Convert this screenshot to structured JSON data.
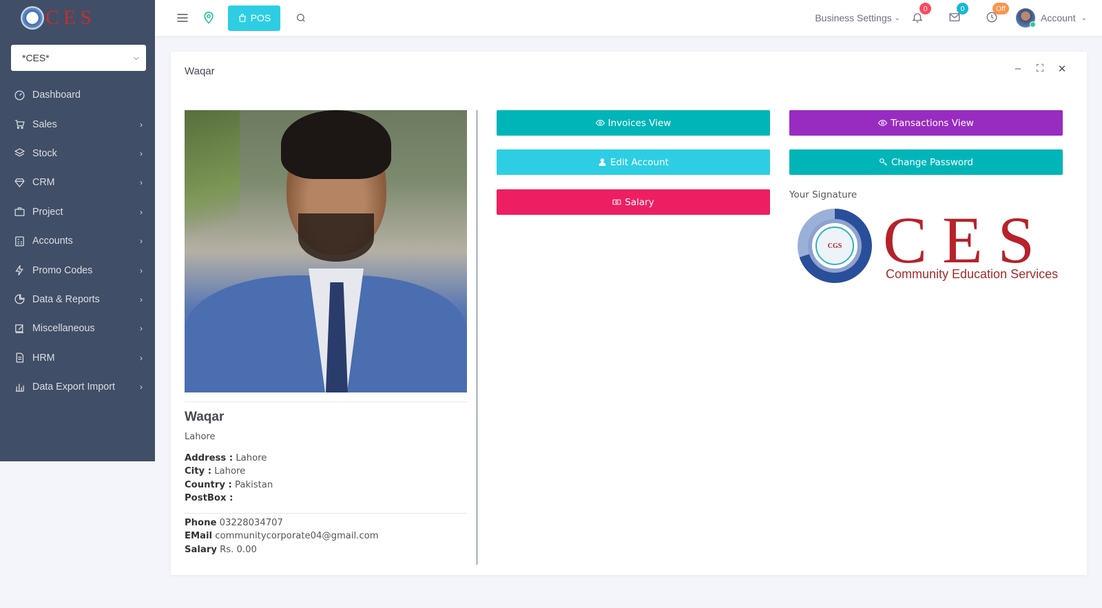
{
  "brand": {
    "logo_text": "CES"
  },
  "sidebar": {
    "store_select": "*CES*",
    "items": [
      {
        "label": "Dashboard",
        "icon": "dashboard-icon",
        "has_arrow": false
      },
      {
        "label": "Sales",
        "icon": "cart-icon",
        "has_arrow": true
      },
      {
        "label": "Stock",
        "icon": "layers-icon",
        "has_arrow": true
      },
      {
        "label": "CRM",
        "icon": "diamond-icon",
        "has_arrow": true
      },
      {
        "label": "Project",
        "icon": "briefcase-icon",
        "has_arrow": true
      },
      {
        "label": "Accounts",
        "icon": "calculator-icon",
        "has_arrow": true
      },
      {
        "label": "Promo Codes",
        "icon": "bolt-icon",
        "has_arrow": true
      },
      {
        "label": "Data & Reports",
        "icon": "pie-icon",
        "has_arrow": true
      },
      {
        "label": "Miscellaneous",
        "icon": "edit-icon",
        "has_arrow": true
      },
      {
        "label": "HRM",
        "icon": "document-icon",
        "has_arrow": true
      },
      {
        "label": "Data Export Import",
        "icon": "bar-chart-icon",
        "has_arrow": true
      }
    ]
  },
  "topbar": {
    "pos_label": "POS",
    "business_settings": "Business Settings",
    "notifications_count": "0",
    "messages_count": "0",
    "clock_status": "Off",
    "account_label": "Account"
  },
  "card": {
    "title": "Waqar",
    "profile": {
      "name": "Waqar",
      "city_line": "Lahore",
      "address_label": "Address :",
      "address": "Lahore",
      "city_label": "City :",
      "city": "Lahore",
      "country_label": "Country :",
      "country": "Pakistan",
      "postbox_label": "PostBox :",
      "postbox": "",
      "phone_label": "Phone",
      "phone": "03228034707",
      "email_label": "EMail",
      "email": "communitycorporate04@gmail.com",
      "salary_label": "Salary",
      "salary": "Rs. 0.00"
    },
    "buttons": {
      "invoices": "Invoices View",
      "transactions": "Transactions View",
      "edit_account": "Edit Account",
      "change_password": "Change Password",
      "salary": "Salary"
    },
    "signature_label": "Your Signature",
    "signature_logo": {
      "text": "CES",
      "subtitle": "Community Education Services",
      "emblem_text": "CGS"
    }
  },
  "colors": {
    "sidebar_bg": "#404e67",
    "cyan": "#2dcee3",
    "teal": "#00b5b8",
    "purple": "#982cc0",
    "pink": "#ed1f62"
  }
}
